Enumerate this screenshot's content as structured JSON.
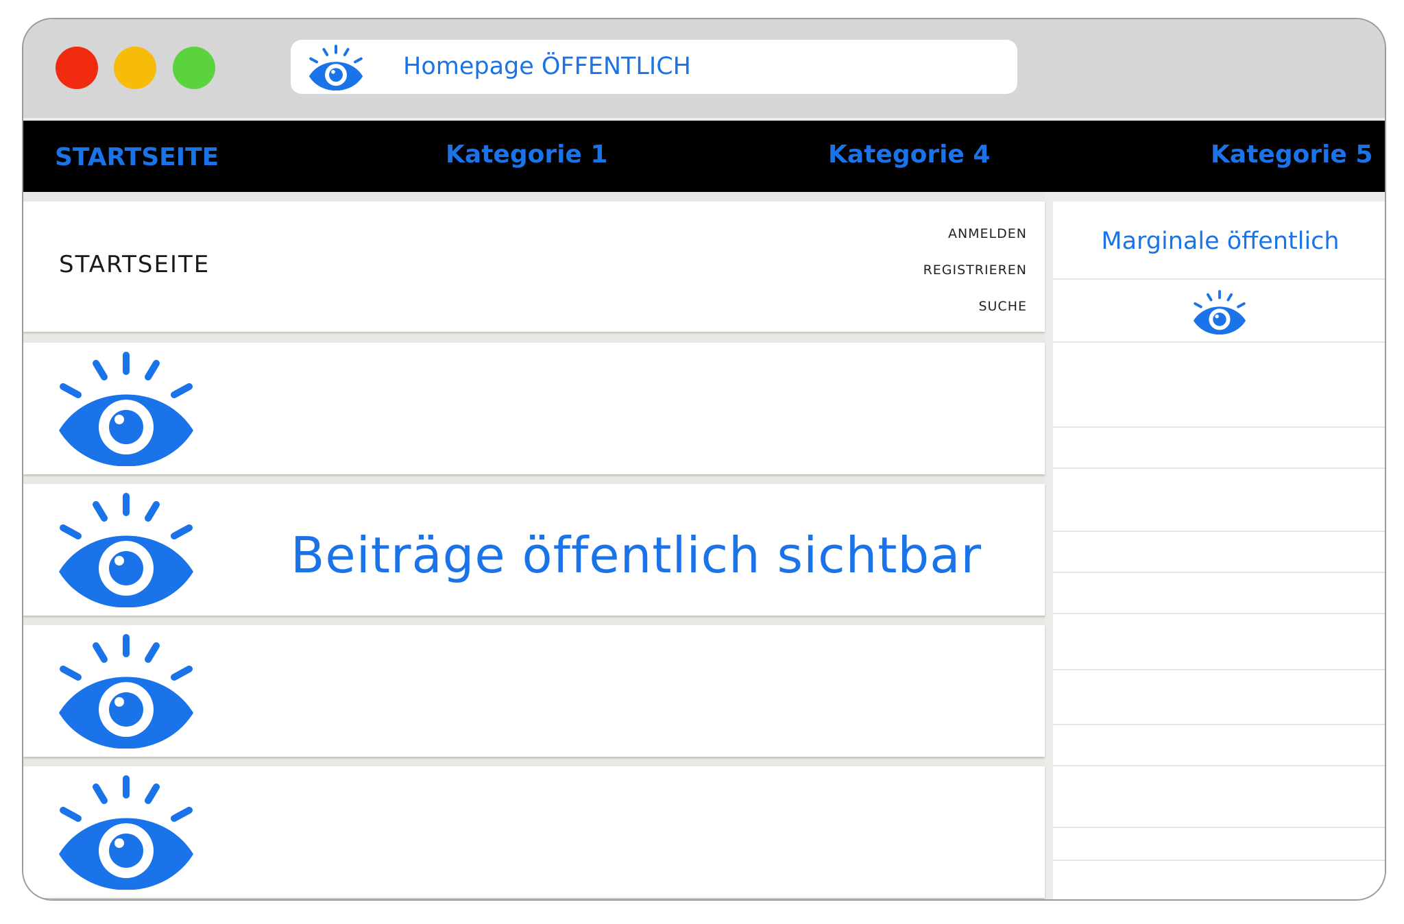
{
  "browser": {
    "address_title": "Homepage ÖFFENTLICH",
    "address_icon": "eye-icon",
    "traffic_lights": {
      "close": "#f12b10",
      "minimize": "#f7bb09",
      "maximize": "#5ad33d"
    }
  },
  "nav": {
    "items": [
      {
        "label": "STARTSEITE"
      },
      {
        "label": "Kategorie 1"
      },
      {
        "label": "Kategorie 4"
      },
      {
        "label": "Kategorie 5"
      }
    ]
  },
  "header": {
    "title": "STARTSEITE",
    "links": [
      {
        "label": "ANMELDEN"
      },
      {
        "label": "REGISTRIEREN"
      },
      {
        "label": "SUCHE"
      }
    ]
  },
  "posts": {
    "icon": "eye-icon",
    "headline": "Beiträge öffentlich sichtbar"
  },
  "sidebar": {
    "title": "Marginale öffentlich",
    "icon": "eye-icon"
  },
  "colors": {
    "accent": "#1a73e8",
    "nav_background": "#000000",
    "titlebar": "#d6d6d6"
  }
}
